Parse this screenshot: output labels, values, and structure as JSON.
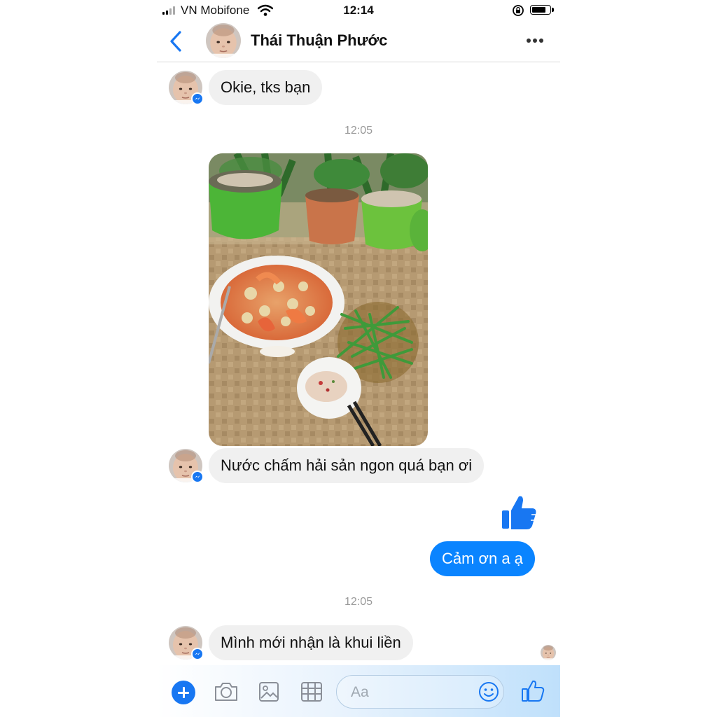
{
  "status_bar": {
    "carrier": "VN Mobifone",
    "time": "12:14"
  },
  "header": {
    "contact_name": "Thái Thuận Phước"
  },
  "messages": [
    {
      "from": "contact",
      "text": "Okie, tks bạn"
    },
    {
      "type": "timestamp",
      "text": "12:05"
    },
    {
      "from": "contact",
      "type": "photo"
    },
    {
      "from": "contact",
      "text": "Nước chấm hải sản ngon quá bạn ơi"
    },
    {
      "from": "me",
      "type": "like"
    },
    {
      "from": "me",
      "text": "Cảm ơn a ạ"
    },
    {
      "type": "timestamp",
      "text": "12:05"
    },
    {
      "from": "contact",
      "text": "Mình mới nhận là khui liền"
    }
  ],
  "composer": {
    "placeholder": "Aa"
  },
  "icons": [
    "back-arrow-icon",
    "more-icon",
    "messenger-badge-icon",
    "thumbs-up-icon",
    "plus-icon",
    "camera-icon",
    "gallery-icon",
    "sticker-grid-icon",
    "emoji-icon",
    "like-button-icon"
  ],
  "colors": {
    "accent": "#1877f2",
    "outgoing_bubble": "#0a84ff",
    "incoming_bubble": "#f0f0f0",
    "timestamp": "#9a9a9a"
  }
}
